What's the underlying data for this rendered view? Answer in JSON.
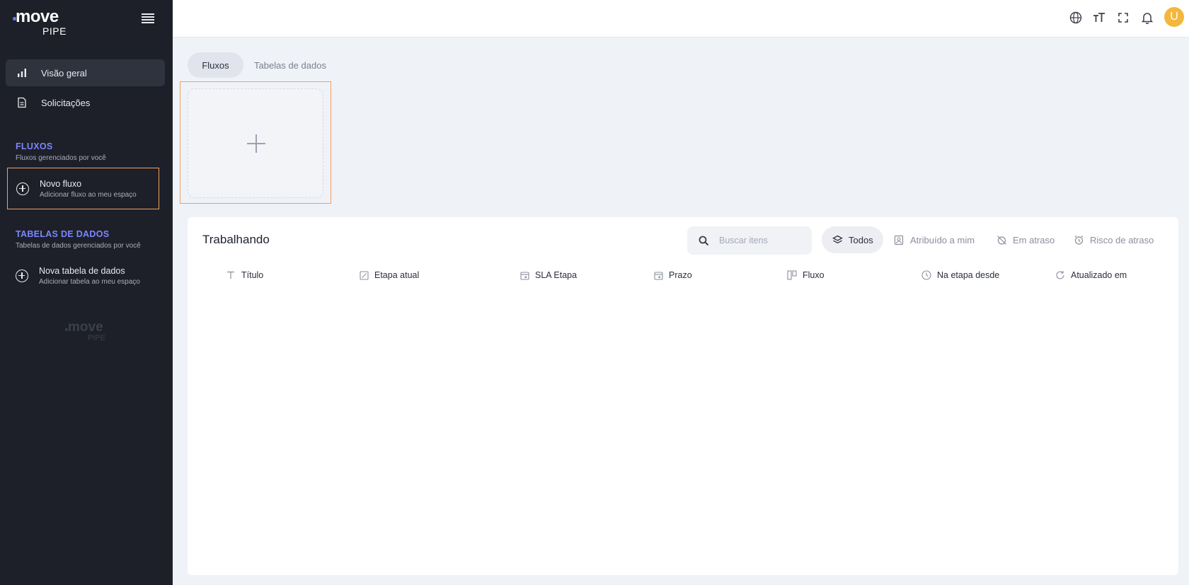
{
  "brand": {
    "logo_word": "move",
    "logo_sub": "PIPE"
  },
  "sidebar": {
    "nav": [
      {
        "label": "Visão geral",
        "icon": "bar-chart-icon",
        "active": true
      },
      {
        "label": "Solicitações",
        "icon": "document-icon",
        "active": false
      }
    ],
    "flows_section": {
      "title": "FLUXOS",
      "subtitle": "Fluxos gerenciados por você",
      "add": {
        "title": "Novo fluxo",
        "subtitle": "Adicionar fluxo ao meu espaço"
      }
    },
    "tables_section": {
      "title": "TABELAS DE DADOS",
      "subtitle": "Tabelas de dados gerenciados por você",
      "add": {
        "title": "Nova tabela de dados",
        "subtitle": "Adicionar tabela ao meu espaço"
      }
    }
  },
  "topbar": {
    "icons": [
      "globe-icon",
      "text-size-icon",
      "fullscreen-icon",
      "bell-icon"
    ],
    "avatar_initial": "U",
    "avatar_color": "#f3b73b"
  },
  "tabs": [
    {
      "label": "Fluxos",
      "active": true
    },
    {
      "label": "Tabelas de dados",
      "active": false
    }
  ],
  "panel": {
    "title": "Trabalhando",
    "search_placeholder": "Buscar itens",
    "filters": [
      {
        "label": "Todos",
        "icon": "layers-icon",
        "active": true
      },
      {
        "label": "Atribuído a mim",
        "icon": "contact-icon",
        "active": false
      },
      {
        "label": "Em atraso",
        "icon": "alarm-off-icon",
        "active": false
      },
      {
        "label": "Risco de atraso",
        "icon": "alarm-icon",
        "active": false
      }
    ],
    "columns": [
      {
        "label": "Título",
        "icon": "text-icon"
      },
      {
        "label": "Etapa atual",
        "icon": "stage-icon"
      },
      {
        "label": "SLA Etapa",
        "icon": "calendar-icon"
      },
      {
        "label": "Prazo",
        "icon": "calendar-icon"
      },
      {
        "label": "Fluxo",
        "icon": "board-icon"
      },
      {
        "label": "Na etapa desde",
        "icon": "clock-icon"
      },
      {
        "label": "Atualizado em",
        "icon": "refresh-icon"
      }
    ]
  },
  "colors": {
    "accent": "#7b86ff",
    "highlight": "#f4a05a",
    "sidebar_bg": "#1d2029"
  }
}
